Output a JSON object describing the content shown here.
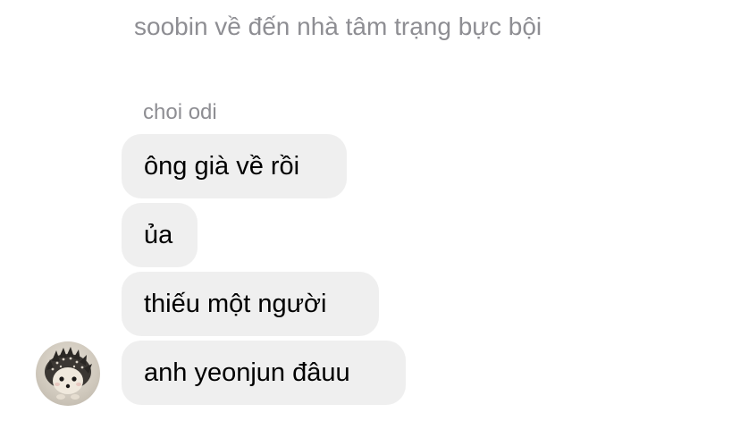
{
  "system_message": "soobin về đến nhà tâm trạng bực bội",
  "sender_name": "choi odi",
  "messages": [
    {
      "text": "ông già về rồi"
    },
    {
      "text": "ủa"
    },
    {
      "text": "thiếu một người"
    },
    {
      "text": "anh yeonjun đâuu"
    }
  ],
  "avatar": {
    "icon": "hedgehog-icon"
  }
}
